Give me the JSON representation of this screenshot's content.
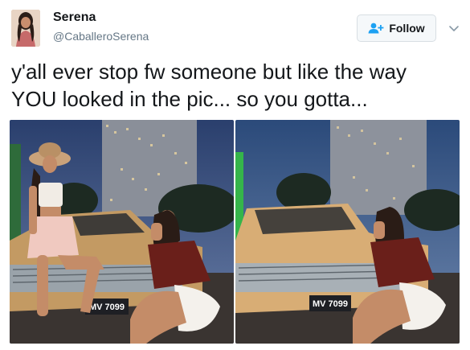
{
  "author": {
    "display_name": "Serena",
    "handle": "@CaballeroSerena",
    "avatar_icon": "user-avatar-photo"
  },
  "follow": {
    "label": "Follow",
    "icon": "add-user-icon"
  },
  "menu": {
    "icon": "chevron-down-icon"
  },
  "tweet": {
    "lines": [
      "y'all ever stop fw someone but like the way",
      "YOU looked in the pic... so you gotta..."
    ]
  },
  "media": [
    {
      "plate": "MV 7099"
    },
    {
      "plate": "MV 7099"
    }
  ],
  "colors": {
    "text": "#14171a",
    "secondary": "#657786",
    "follow_icon": "#1da1f2",
    "button_border": "#d8dee3"
  }
}
